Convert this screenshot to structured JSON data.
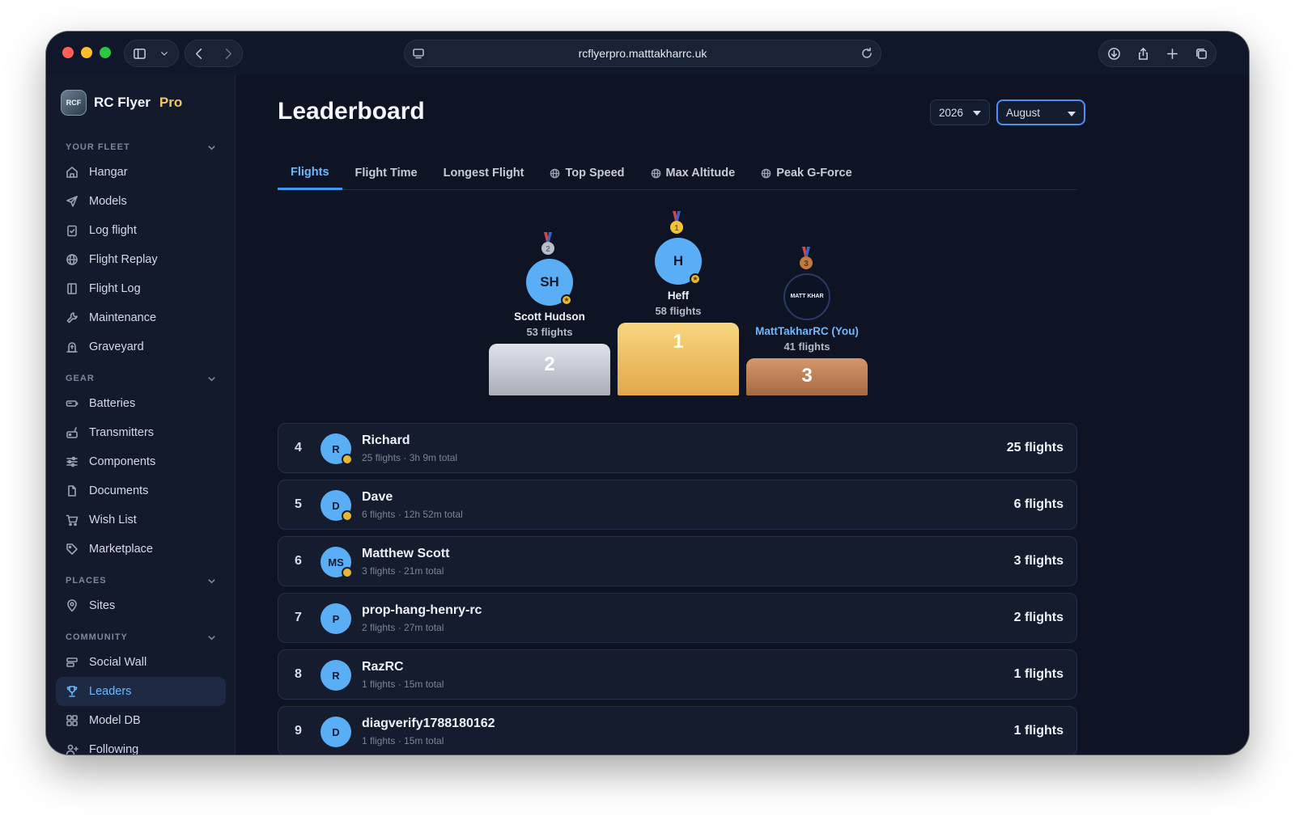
{
  "browser": {
    "url": "rcflyerpro.matttakharrc.uk"
  },
  "brand": {
    "logo_text": "RCF",
    "name": "RC Flyer",
    "tier": "Pro"
  },
  "sidebar": {
    "sections": [
      {
        "title": "YOUR FLEET",
        "items": [
          {
            "label": "Hangar",
            "icon": "home-icon"
          },
          {
            "label": "Models",
            "icon": "paper-plane-icon"
          },
          {
            "label": "Log flight",
            "icon": "clipboard-check-icon"
          },
          {
            "label": "Flight Replay",
            "icon": "globe-icon"
          },
          {
            "label": "Flight Log",
            "icon": "book-icon"
          },
          {
            "label": "Maintenance",
            "icon": "wrench-icon"
          },
          {
            "label": "Graveyard",
            "icon": "tombstone-icon"
          }
        ]
      },
      {
        "title": "GEAR",
        "items": [
          {
            "label": "Batteries",
            "icon": "battery-icon"
          },
          {
            "label": "Transmitters",
            "icon": "transmitter-icon"
          },
          {
            "label": "Components",
            "icon": "sliders-icon"
          },
          {
            "label": "Documents",
            "icon": "document-icon"
          },
          {
            "label": "Wish List",
            "icon": "cart-icon"
          },
          {
            "label": "Marketplace",
            "icon": "tag-icon"
          }
        ]
      },
      {
        "title": "PLACES",
        "items": [
          {
            "label": "Sites",
            "icon": "map-pin-icon"
          }
        ]
      },
      {
        "title": "COMMUNITY",
        "items": [
          {
            "label": "Social Wall",
            "icon": "wall-icon"
          },
          {
            "label": "Leaders",
            "icon": "trophy-icon",
            "active": true
          },
          {
            "label": "Model DB",
            "icon": "grid-icon"
          },
          {
            "label": "Following",
            "icon": "user-plus-icon"
          }
        ]
      }
    ]
  },
  "page": {
    "title": "Leaderboard",
    "year": "2026",
    "month": "August"
  },
  "tabs": [
    {
      "label": "Flights",
      "active": true,
      "globe": false
    },
    {
      "label": "Flight Time",
      "active": false,
      "globe": false
    },
    {
      "label": "Longest Flight",
      "active": false,
      "globe": false
    },
    {
      "label": "Top Speed",
      "active": false,
      "globe": true
    },
    {
      "label": "Max Altitude",
      "active": false,
      "globe": true
    },
    {
      "label": "Peak G-Force",
      "active": false,
      "globe": true
    }
  ],
  "podium": {
    "first": {
      "rank": "1",
      "initials": "H",
      "name": "Heff",
      "flights": "58 flights"
    },
    "second": {
      "rank": "2",
      "initials": "SH",
      "name": "Scott Hudson",
      "flights": "53 flights"
    },
    "third": {
      "rank": "3",
      "initials": "MATT KHAR",
      "name": "MattTakharRC (You)",
      "flights": "41 flights"
    }
  },
  "rows": [
    {
      "rank": "4",
      "initials": "R",
      "name": "Richard",
      "sub": "25 flights · 3h 9m total",
      "count": "25 flights",
      "star": true
    },
    {
      "rank": "5",
      "initials": "D",
      "name": "Dave",
      "sub": "6 flights · 12h 52m total",
      "count": "6 flights",
      "star": true
    },
    {
      "rank": "6",
      "initials": "MS",
      "name": "Matthew Scott",
      "sub": "3 flights · 21m total",
      "count": "3 flights",
      "star": true
    },
    {
      "rank": "7",
      "initials": "P",
      "name": "prop-hang-henry-rc",
      "sub": "2 flights · 27m total",
      "count": "2 flights",
      "star": false
    },
    {
      "rank": "8",
      "initials": "R",
      "name": "RazRC",
      "sub": "1 flights · 15m total",
      "count": "1 flights",
      "star": false
    },
    {
      "rank": "9",
      "initials": "D",
      "name": "diagverify1788180162",
      "sub": "1 flights · 15m total",
      "count": "1 flights",
      "star": false
    }
  ],
  "colors": {
    "accent": "#3e96f0",
    "gold": "#f2c75b",
    "silver": "#c4c8d2",
    "bronze": "#b87b52"
  }
}
